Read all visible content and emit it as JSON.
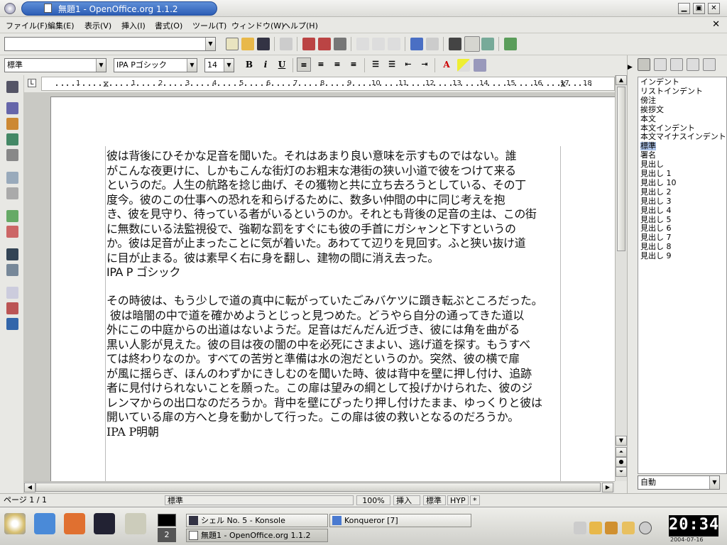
{
  "window": {
    "title": "無題1 - OpenOffice.org 1.1.2"
  },
  "menu": [
    "ファイル(F)",
    "編集(E)",
    "表示(V)",
    "挿入(I)",
    "書式(O)",
    "ツール(T)",
    "ウィンドウ(W)",
    "ヘルプ(H)"
  ],
  "toolbar": {
    "url_value": ""
  },
  "format": {
    "style": "標準",
    "font": "IPA Pゴシック",
    "size": "14",
    "bold": "B",
    "italic": "i",
    "underline": "U"
  },
  "ruler": {
    "ticks": [
      "1",
      "1",
      "2",
      "3",
      "4",
      "5",
      "6",
      "7",
      "8",
      "9",
      "10",
      "11",
      "12",
      "13",
      "14",
      "15",
      "16",
      "17",
      "18"
    ]
  },
  "document": {
    "paragraphs_sans": [
      "彼は背後にひそかな足音を聞いた。それはあまり良い意味を示すものではない。誰",
      "がこんな夜更けに、しかもこんな街灯のお粗末な港街の狭い小道で彼をつけて来る",
      "というのだ。人生の航路を捻じ曲げ、その獲物と共に立ち去ろうとしている、その丁",
      "度今。彼のこの仕事への恐れを和らげるために、数多い仲間の中に同じ考えを抱",
      "き、彼を見守り、待っている者がいるというのか。それとも背後の足音の主は、この街",
      "に無数にいる法監視役で、強靭な罰をすぐにも彼の手首にガシャンと下すというの",
      "か。彼は足音が止まったことに気が着いた。あわてて辺りを見回す。ふと狭い抜け道",
      "に目が止まる。彼は素早く右に身を翻し、建物の間に消え去った。",
      "IPA P ゴシック"
    ],
    "paragraphs_serif": [
      "その時彼は、もう少しで道の真中に転がっていたごみバケツに躓き転ぶところだった。",
      " 彼は暗闇の中で道を確かめようとじっと見つめた。どうやら自分の通ってきた道以",
      "外にこの中庭からの出道はないようだ。足音はだんだん近づき、彼には角を曲がる",
      "黒い人影が見えた。彼の目は夜の闇の中を必死にさまよい、逃げ道を探す。もうすべ",
      "ては終わりなのか。すべての苦労と準備は水の泡だというのか。突然、彼の横で扉",
      "が風に揺らぎ、ほんのわずかにきしむのを聞いた時、彼は背中を壁に押し付け、追跡",
      "者に見付けられないことを願った。この扉は望みの綱として投げかけられた、彼のジ",
      "レンマからの出口なのだろうか。背中を壁にぴったり押し付けたまま、ゆっくりと彼は",
      "開いている扉の方へと身を動かして行った。この扉は彼の救いとなるのだろうか。",
      "IPA P明朝"
    ]
  },
  "stylist": {
    "items": [
      "インデント",
      "リストインデント",
      "傍注",
      "挨拶文",
      "本文",
      "本文インデント",
      "本文マイナスインデント",
      "標準",
      "署名",
      "見出し",
      "見出し 1",
      "見出し 10",
      "見出し 2",
      "見出し 3",
      "見出し 4",
      "見出し 5",
      "見出し 6",
      "見出し 7",
      "見出し 8",
      "見出し 9"
    ],
    "selected": "標準",
    "filter": "自動"
  },
  "status": {
    "page": "ページ 1 / 1",
    "style": "標準",
    "zoom": "100%",
    "insert": "挿入",
    "mode": "標準",
    "hyp": "HYP",
    "modified": "*"
  },
  "taskbar": {
    "pager": "2",
    "tasks": [
      "シェル No. 5 - Konsole",
      "Konqueror [7]",
      "無題1 - OpenOffice.org 1.1.2"
    ],
    "clock": "20:34",
    "date": "2004-07-16"
  }
}
